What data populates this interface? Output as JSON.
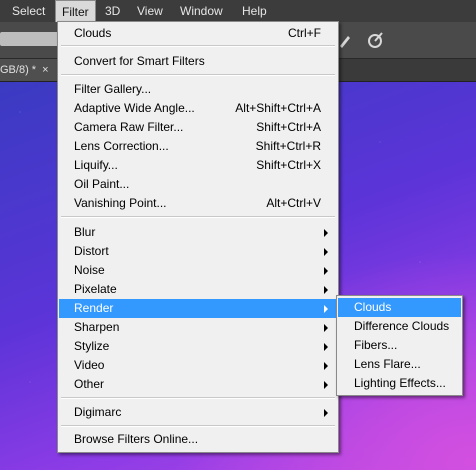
{
  "menubar": {
    "items": [
      {
        "label": "Select"
      },
      {
        "label": "Filter"
      },
      {
        "label": "3D"
      },
      {
        "label": "View"
      },
      {
        "label": "Window"
      },
      {
        "label": "Help"
      }
    ]
  },
  "document_tab": {
    "label": "GB/8) *",
    "close": "×"
  },
  "filter_menu": {
    "items": [
      {
        "label": "Clouds",
        "shortcut": "Ctrl+F"
      },
      {
        "label": "Convert for Smart Filters"
      },
      {
        "label": "Filter Gallery..."
      },
      {
        "label": "Adaptive Wide Angle...",
        "shortcut": "Alt+Shift+Ctrl+A"
      },
      {
        "label": "Camera Raw Filter...",
        "shortcut": "Shift+Ctrl+A"
      },
      {
        "label": "Lens Correction...",
        "shortcut": "Shift+Ctrl+R"
      },
      {
        "label": "Liquify...",
        "shortcut": "Shift+Ctrl+X"
      },
      {
        "label": "Oil Paint..."
      },
      {
        "label": "Vanishing Point...",
        "shortcut": "Alt+Ctrl+V"
      },
      {
        "label": "Blur"
      },
      {
        "label": "Distort"
      },
      {
        "label": "Noise"
      },
      {
        "label": "Pixelate"
      },
      {
        "label": "Render"
      },
      {
        "label": "Sharpen"
      },
      {
        "label": "Stylize"
      },
      {
        "label": "Video"
      },
      {
        "label": "Other"
      },
      {
        "label": "Digimarc"
      },
      {
        "label": "Browse Filters Online..."
      }
    ]
  },
  "render_submenu": {
    "items": [
      {
        "label": "Clouds"
      },
      {
        "label": "Difference Clouds"
      },
      {
        "label": "Fibers..."
      },
      {
        "label": "Lens Flare..."
      },
      {
        "label": "Lighting Effects..."
      }
    ]
  },
  "colors": {
    "highlight": "#3399ff",
    "menu_bg": "#f0f0f0",
    "menubar_bg": "#3c3c3c"
  }
}
